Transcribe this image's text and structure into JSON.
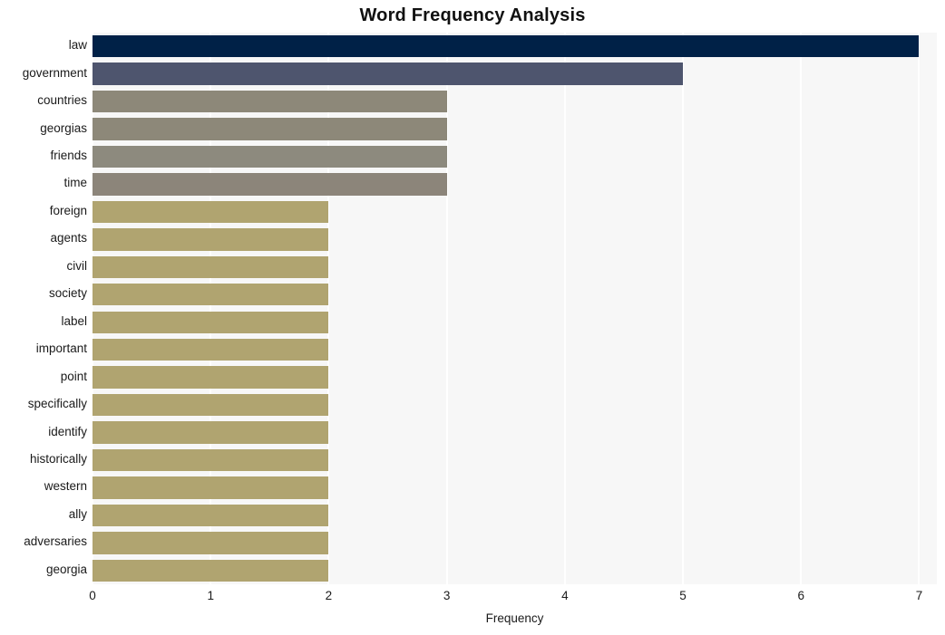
{
  "chart_data": {
    "type": "bar",
    "orientation": "horizontal",
    "title": "Word Frequency Analysis",
    "xlabel": "Frequency",
    "ylabel": "",
    "xlim": [
      0,
      7.15
    ],
    "xticks": [
      0,
      1,
      2,
      3,
      4,
      5,
      6,
      7
    ],
    "xtick_labels": [
      "0",
      "1",
      "2",
      "3",
      "4",
      "5",
      "6",
      "7"
    ],
    "grid": "vertical-white-on-light-gray",
    "legend": "none",
    "categories": [
      "law",
      "government",
      "countries",
      "georgias",
      "friends",
      "time",
      "foreign",
      "agents",
      "civil",
      "society",
      "label",
      "important",
      "point",
      "specifically",
      "identify",
      "historically",
      "western",
      "ally",
      "adversaries",
      "georgia"
    ],
    "values": [
      7,
      5,
      3,
      3,
      3,
      3,
      2,
      2,
      2,
      2,
      2,
      2,
      2,
      2,
      2,
      2,
      2,
      2,
      2,
      2
    ],
    "bar_colors": [
      "#002147",
      "#4e556e",
      "#8d8879",
      "#8d8879",
      "#8d8a7e",
      "#8c857a",
      "#b0a470",
      "#b0a470",
      "#b0a470",
      "#b0a470",
      "#b0a470",
      "#b0a470",
      "#b0a470",
      "#b0a470",
      "#b0a470",
      "#b0a470",
      "#b0a470",
      "#b0a470",
      "#b0a470",
      "#b0a470"
    ],
    "plot_background": "#f7f7f7",
    "figure_background": "#ffffff",
    "gridline_color": "#ffffff",
    "text_color": "#1a1a1a"
  }
}
